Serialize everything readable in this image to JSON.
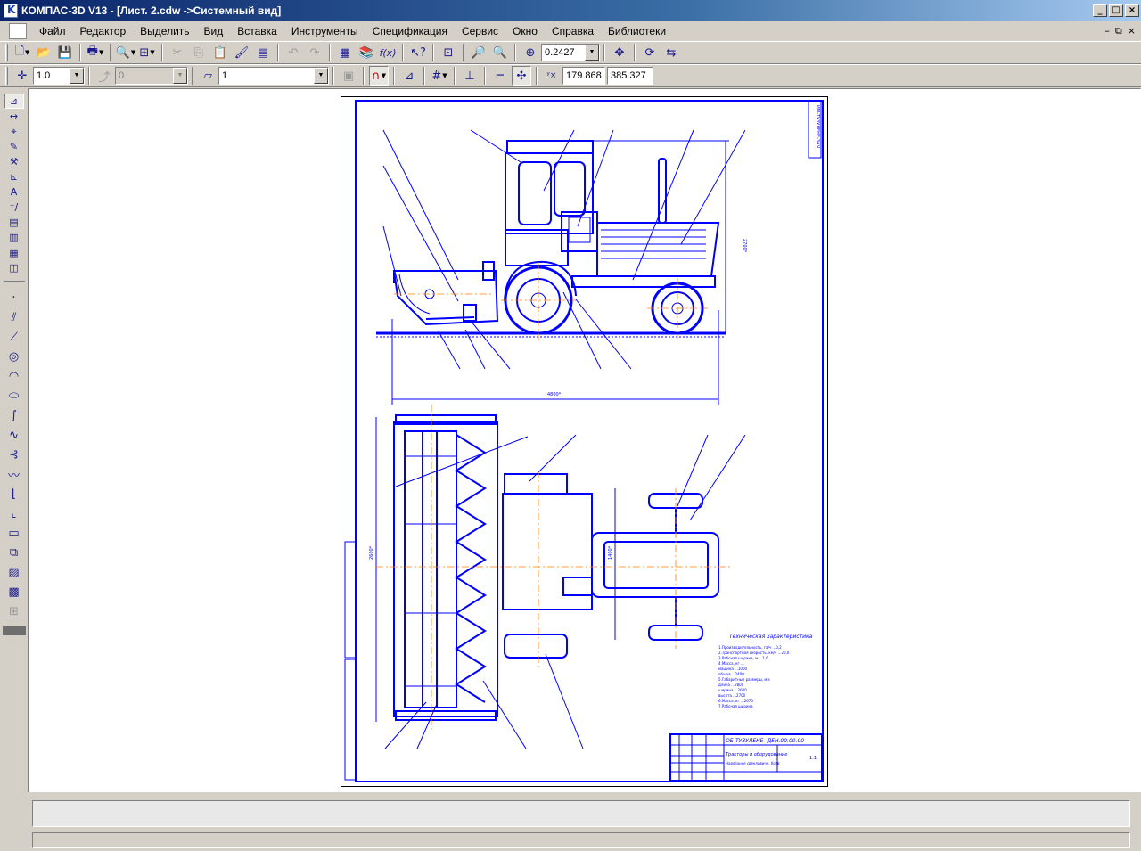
{
  "window": {
    "title": "КОМПАС-3D V13 - [Лист. 2.cdw ->Системный вид]",
    "buttons": [
      "_",
      "□",
      "×"
    ]
  },
  "menu": {
    "items": [
      "Файл",
      "Редактор",
      "Выделить",
      "Вид",
      "Вставка",
      "Инструменты",
      "Спецификация",
      "Сервис",
      "Окно",
      "Справка",
      "Библиотеки"
    ],
    "mdi_buttons": [
      "–",
      "⧉",
      "×"
    ]
  },
  "toolbar1": {
    "zoom_value": "0.2427",
    "icons": [
      "new-document-icon",
      "open-icon",
      "save-icon",
      "print-icon",
      "preview-icon",
      "properties-icon",
      "cut-icon",
      "copy-icon",
      "paste-icon",
      "format-brush-icon",
      "text-icon",
      "undo-icon",
      "redo-icon",
      "manager-icon",
      "library-icon",
      "variables-icon",
      "help-icon",
      "zoom-window-icon",
      "zoom-out-icon",
      "zoom-in-icon",
      "zoom-scale-icon",
      "pan-icon",
      "refresh-icon",
      "redraw-icon"
    ]
  },
  "toolbar2": {
    "step_value": "1.0",
    "angle_value": "0",
    "layer_value": "1",
    "coord_x": "179.868",
    "coord_y": "385.327"
  },
  "drawing": {
    "frame_stamp_text": "ИМ-ТУЗУЛЕНЕ-ЗАЧ",
    "title_block_code": "ОБ-ТУЗУЛЕНЕ- ДЕН.00.00.00",
    "title_block_name": "Тракторы и оборудование",
    "title_block_name2": "Нарезание свекловичн. ботв",
    "title_block_sheet": "1:1",
    "spec_heading": "Техническая характеристика",
    "spec_lines": [
      "1.Производительность, га/ч  ...0,2",
      "2.Транспортная скорость, км/ч ...20,0",
      "3.Рабочая ширина, м  ...1,0",
      "4.Масса, кг  ...",
      "   машина  ...1000",
      "   общая  ...2400",
      "5.Габаритные размеры, мм",
      "   длина  ...2800",
      "   ширина  ...2600",
      "   высота  ...2700",
      "6.Масса, кг  ...2670",
      "7.Рабочая ширина"
    ],
    "dim_height": "2700*",
    "dim_length": "4800*",
    "dim_width": "2600*",
    "dim_track": "1400*"
  },
  "status": {
    "prompt": "",
    "line": ""
  },
  "colors": {
    "drawing_blue": "#0000ff",
    "axis_orange": "#ff8000",
    "titlebar_start": "#0a246a"
  }
}
